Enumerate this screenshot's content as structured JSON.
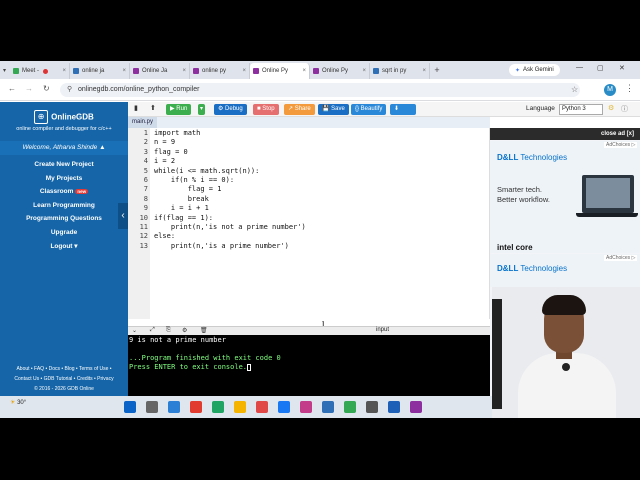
{
  "browser": {
    "tabs": [
      {
        "label": "Meet -",
        "color": "#34a853"
      },
      {
        "label": "online ja",
        "color": "#2f6fb5"
      },
      {
        "label": "Online Ja",
        "color": "#8e2fa0"
      },
      {
        "label": "online py",
        "color": "#8e2fa0"
      },
      {
        "label": "Online Py",
        "color": "#8e2fa0"
      },
      {
        "label": "Online Py",
        "color": "#8e2fa0"
      },
      {
        "label": "sqrt in py",
        "color": "#2f6fb5"
      }
    ],
    "active_tab_index": 4,
    "new_tab": "+",
    "ask_gemini": "Ask Gemini",
    "url": "onlinegdb.com/online_python_compiler",
    "profile_initial": "M"
  },
  "sidebar": {
    "logo": "OnlineGDB",
    "tagline": "online compiler and debugger for c/c++",
    "welcome": "Welcome, Atharva Shinde ▲",
    "items": [
      {
        "label": "Create New Project"
      },
      {
        "label": "My Projects"
      },
      {
        "label": "Classroom",
        "badge": "new"
      },
      {
        "label": "Learn Programming"
      },
      {
        "label": "Programming Questions"
      },
      {
        "label": "Upgrade"
      },
      {
        "label": "Logout  ▾"
      }
    ],
    "footer_line1": "About • FAQ • Docs • Blog • Terms of Use •",
    "footer_line2": "Contact Us • GDB Tutorial • Credits • Privacy",
    "footer_line3": "© 2016 - 2026 GDB Online"
  },
  "toolbar": {
    "run": "▶ Run",
    "debug": "⚙ Debug",
    "stop": "■ Stop",
    "share": "↗ Share",
    "save": "💾 Save",
    "beautify": "{} Beautify",
    "download": "⬇",
    "language_label": "Language",
    "language_value": "Python 3"
  },
  "editor": {
    "filename": "main.py",
    "lines": [
      {
        "n": "1",
        "text": "import math"
      },
      {
        "n": "2",
        "text": "n = 9"
      },
      {
        "n": "3",
        "text": "flag = 0"
      },
      {
        "n": "4",
        "text": "i = 2"
      },
      {
        "n": "5",
        "text": "while(i <= math.sqrt(n)):"
      },
      {
        "n": "6",
        "text": "    if(n % i == 0):"
      },
      {
        "n": "7",
        "text": "        flag = 1"
      },
      {
        "n": "8",
        "text": "        break"
      },
      {
        "n": "9",
        "text": "    i = i + 1"
      },
      {
        "n": "10",
        "text": "if(flag == 1):"
      },
      {
        "n": "11",
        "text": "    print(n,'is not a prime number')"
      },
      {
        "n": "12",
        "text": "else:"
      },
      {
        "n": "13",
        "text": "    print(n,'is a prime number')"
      }
    ]
  },
  "console": {
    "input_label": "input",
    "output_line1": "9 is not a prime number",
    "output_line2": "...Program finished with exit code 0",
    "output_line3": "Press ENTER to exit console."
  },
  "ads": {
    "close": "close ad [x]",
    "adchoices": "AdChoices ▷",
    "brand": "D&LL",
    "brand_suffix": "Technologies",
    "line1": "Smarter tech.",
    "line2": "Better workflow.",
    "intel": "intel core"
  },
  "taskbar": {
    "weather": "30°",
    "apps": [
      "#0a64c8",
      "#666",
      "#2b7fd4",
      "#e03b2e",
      "#1fa463",
      "#f4b400",
      "#e04848",
      "#1877f2",
      "#c23c8a",
      "#2f6fb5",
      "#34a853",
      "#555",
      "#1e5fb8",
      "#8e2fa0"
    ]
  }
}
